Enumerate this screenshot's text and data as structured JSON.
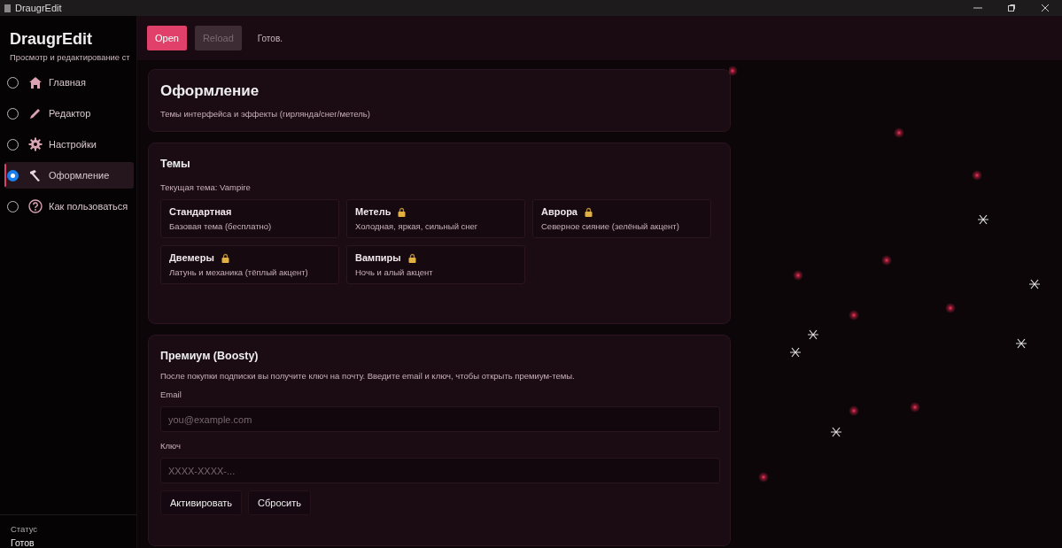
{
  "window": {
    "title": "DraugrEdit"
  },
  "sidebar": {
    "app_title": "DraugrEdit",
    "subtitle": "Просмотр и редактирование ст",
    "items": [
      {
        "label": "Главная",
        "kind": "home",
        "selected": false
      },
      {
        "label": "Редактор",
        "kind": "pencil",
        "selected": false
      },
      {
        "label": "Настройки",
        "kind": "gear",
        "selected": false
      },
      {
        "label": "Оформление",
        "kind": "brush",
        "selected": true
      },
      {
        "label": "Как пользоваться",
        "kind": "help",
        "selected": false
      }
    ],
    "status_label": "Статус",
    "status_value": "Готов"
  },
  "toolbar": {
    "buttons": [
      {
        "label": "Open",
        "kind": "primary",
        "disabled": false
      },
      {
        "label": "Reload",
        "kind": "secondary",
        "disabled": true
      }
    ],
    "status": "Готов."
  },
  "header": {
    "title": "Оформление",
    "subtitle": "Темы интерфейса и эффекты (гирлянда/снег/метель)"
  },
  "themes": {
    "title": "Темы",
    "current": "Текущая тема: Vampire",
    "items": [
      {
        "name": "Стандартная",
        "description": "Базовая тема (бесплатно)",
        "locked": false
      },
      {
        "name": "Метель",
        "description": "Холодная, яркая, сильный снег",
        "locked": true
      },
      {
        "name": "Аврора",
        "description": "Северное сияние (зелёный акцент)",
        "locked": true
      },
      {
        "name": "Двемеры",
        "description": "Латунь и механика (тёплый акцент)",
        "locked": true
      },
      {
        "name": "Вампиры",
        "description": "Ночь и алый акцент",
        "locked": true
      }
    ]
  },
  "premium": {
    "title": "Премиум (Boosty)",
    "description": "После покупки подписки вы получите ключ на почту. Введите email и ключ, чтобы открыть премиум-темы.",
    "fields": [
      {
        "label": "Email",
        "placeholder": "you@example.com"
      },
      {
        "label": "Ключ",
        "placeholder": "XXXX-XXXX-..."
      }
    ],
    "buttons": [
      "Активировать",
      "Сбросить"
    ]
  }
}
